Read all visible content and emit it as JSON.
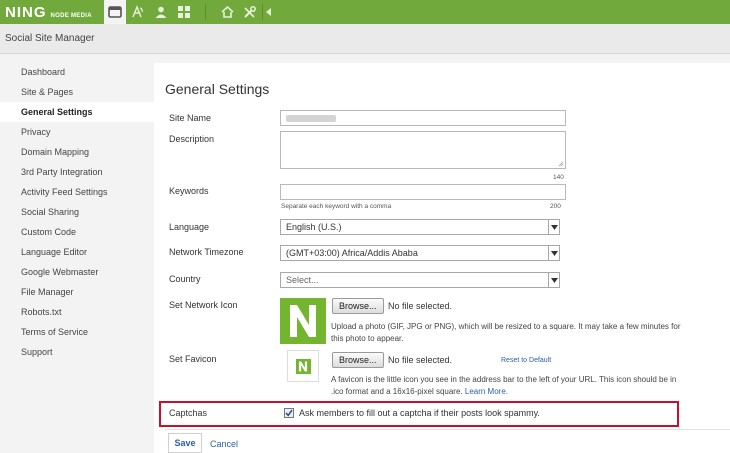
{
  "topbar": {
    "brand": "NING",
    "brand_sub": "NODE MEDIA",
    "icons": [
      "window-icon",
      "design-icon",
      "person-icon",
      "apps-icon",
      "home-icon",
      "tools-icon",
      "collapse-icon"
    ]
  },
  "subheader": {
    "title": "Social Site Manager"
  },
  "sidebar": {
    "items": [
      {
        "label": "Dashboard",
        "active": false
      },
      {
        "label": "Site & Pages",
        "active": false
      },
      {
        "label": "General Settings",
        "active": true
      },
      {
        "label": "Privacy",
        "active": false
      },
      {
        "label": "Domain Mapping",
        "active": false
      },
      {
        "label": "3rd Party Integration",
        "active": false
      },
      {
        "label": "Activity Feed Settings",
        "active": false
      },
      {
        "label": "Social Sharing",
        "active": false
      },
      {
        "label": "Custom Code",
        "active": false
      },
      {
        "label": "Language Editor",
        "active": false
      },
      {
        "label": "Google Webmaster",
        "active": false
      },
      {
        "label": "File Manager",
        "active": false
      },
      {
        "label": "Robots.txt",
        "active": false
      },
      {
        "label": "Terms of Service",
        "active": false
      },
      {
        "label": "Support",
        "active": false
      }
    ]
  },
  "main": {
    "title": "General Settings",
    "site_name": {
      "label": "Site Name",
      "value": ""
    },
    "description": {
      "label": "Description",
      "counter": "140"
    },
    "keywords": {
      "label": "Keywords",
      "hint": "Separate each keyword with a comma",
      "counter": "200"
    },
    "language": {
      "label": "Language",
      "value": "English (U.S.)"
    },
    "timezone": {
      "label": "Network Timezone",
      "value": "(GMT+03:00) Africa/Addis Ababa"
    },
    "country": {
      "label": "Country",
      "value": "Select..."
    },
    "network_icon": {
      "label": "Set Network Icon",
      "button": "Browse...",
      "state": "No file selected.",
      "help_line1": "Upload a photo (GIF, JPG or PNG), which will be resized to a square. It may take a few minutes for",
      "help_line2": "this photo to appear."
    },
    "favicon": {
      "label": "Set Favicon",
      "button": "Browse...",
      "state": "No file selected.",
      "reset": "Reset to Default",
      "help_line1": "A favicon is the little icon you see in the address bar to the left of your URL. This icon should be in",
      "help_line2": ".ico format and a 16x16-pixel square.",
      "learn_more": "Learn More."
    },
    "captchas": {
      "label": "Captchas",
      "checked": true,
      "text": "Ask members to fill out a captcha if their posts look spammy."
    },
    "save": "Save",
    "cancel": "Cancel"
  },
  "colors": {
    "brand_green": "#72a93d",
    "link": "#2a5fa5",
    "highlight": "#c8102e"
  }
}
